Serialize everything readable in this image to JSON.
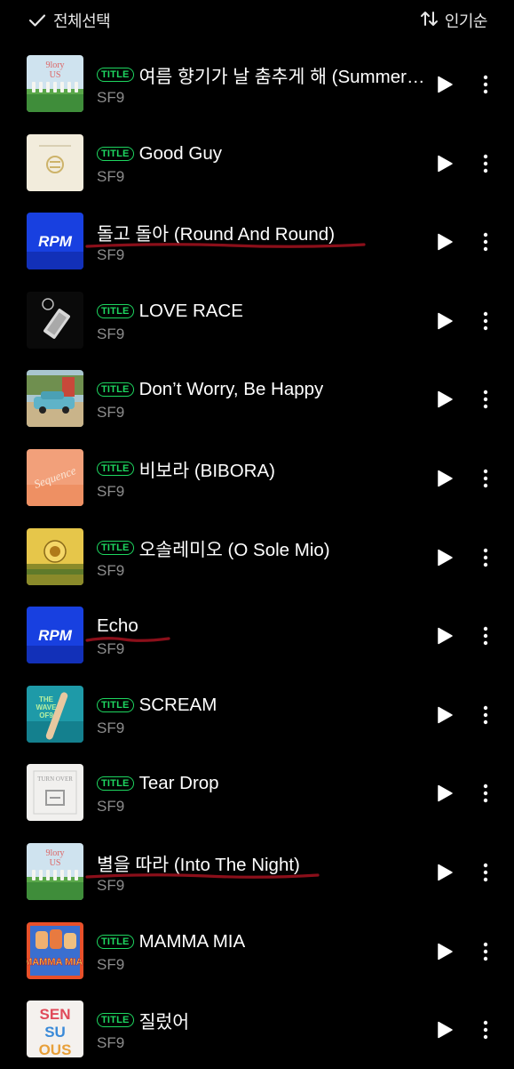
{
  "header": {
    "select_all_label": "전체선택",
    "sort_label": "인기순"
  },
  "songs": [
    {
      "title": "여름 향기가 날 춤추게 해 (Summer Breeze)",
      "artist": "SF9",
      "badge": "TITLE",
      "art": "green-field"
    },
    {
      "title": "Good Guy",
      "artist": "SF9",
      "badge": "TITLE",
      "art": "cream-logo"
    },
    {
      "title": "돌고 돌아 (Round And Round)",
      "artist": "SF9",
      "badge": "",
      "art": "blue-rpm",
      "art_text": "RPM",
      "underlined": true
    },
    {
      "title": "LOVE RACE",
      "artist": "SF9",
      "badge": "TITLE",
      "art": "black-keychain"
    },
    {
      "title": "Don’t Worry, Be Happy",
      "artist": "SF9",
      "badge": "TITLE",
      "art": "vintage-car"
    },
    {
      "title": "비보라 (BIBORA)",
      "artist": "SF9",
      "badge": "TITLE",
      "art": "orange-sequence",
      "art_text": "Sequence"
    },
    {
      "title": "오솔레미오 (O Sole Mio)",
      "artist": "SF9",
      "badge": "TITLE",
      "art": "gold-sun"
    },
    {
      "title": "Echo",
      "artist": "SF9",
      "badge": "",
      "art": "blue-rpm",
      "art_text": "RPM",
      "underlined": true
    },
    {
      "title": "SCREAM",
      "artist": "SF9",
      "badge": "TITLE",
      "art": "teal-wave",
      "art_text": "THE WAVE OF9"
    },
    {
      "title": "Tear Drop",
      "artist": "SF9",
      "badge": "TITLE",
      "art": "white-turnover",
      "art_text": "TURN OVER"
    },
    {
      "title": "별을 따라 (Into The Night)",
      "artist": "SF9",
      "badge": "",
      "art": "green-field",
      "underlined": true
    },
    {
      "title": "MAMMA MIA",
      "artist": "SF9",
      "badge": "TITLE",
      "art": "red-mammamia",
      "art_text": "MAMMA MIA!"
    },
    {
      "title": "질렀어",
      "artist": "SF9",
      "badge": "TITLE",
      "art": "white-sensuous",
      "art_text": "SEN SU OUS"
    }
  ],
  "colors": {
    "background": "#000000",
    "badge": "#1ed760",
    "artist_text": "#8d8d8d",
    "underline": "#8b0f1a"
  },
  "icons": {
    "select_all": "checkmark-icon",
    "sort": "sort-arrows-icon",
    "play": "play-icon",
    "more": "more-vertical-icon"
  }
}
